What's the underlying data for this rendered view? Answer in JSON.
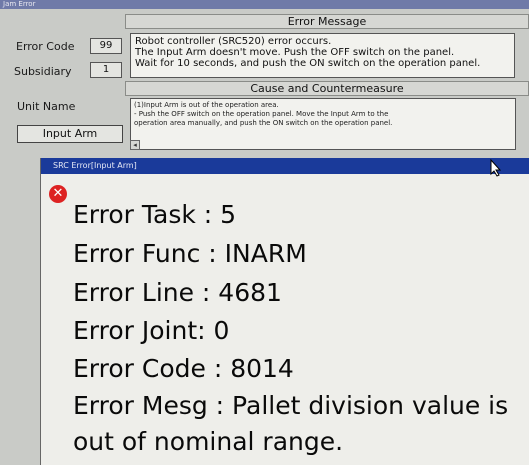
{
  "window": {
    "title": "Jam Error"
  },
  "error_message": {
    "header": "Error Message",
    "error_code_label": "Error Code",
    "error_code_value": "99",
    "subsidiary_label": "Subsidiary",
    "subsidiary_value": "1",
    "lines": [
      "Robot controller (SRC520) error occurs.",
      "  The Input Arm doesn't move. Push the OFF switch on the panel.",
      "Wait for 10 seconds, and push the ON switch on the operation panel."
    ]
  },
  "cause": {
    "header": "Cause and Countermeasure",
    "unit_name_label": "Unit Name",
    "unit_name_value": "Input Arm",
    "lines": [
      "(1)Input Arm is out of the operation area.",
      "  - Push the OFF switch on the operation panel. Move the Input Arm to the",
      "    operation area manually, and push the ON switch on the operation panel."
    ],
    "scroll_glyph": "◂"
  },
  "popup": {
    "title": "SRC Error[Input Arm]",
    "icon": "error-icon",
    "icon_glyph": "✕",
    "icon_color": "#dd2222",
    "lines": [
      "Error Task : 5",
      "Error Func : INARM",
      "Error Line : 4681",
      "Error Joint: 0",
      "Error Code : 8014",
      "Error Mesg : Pallet division value is",
      "out of nominal range."
    ]
  }
}
